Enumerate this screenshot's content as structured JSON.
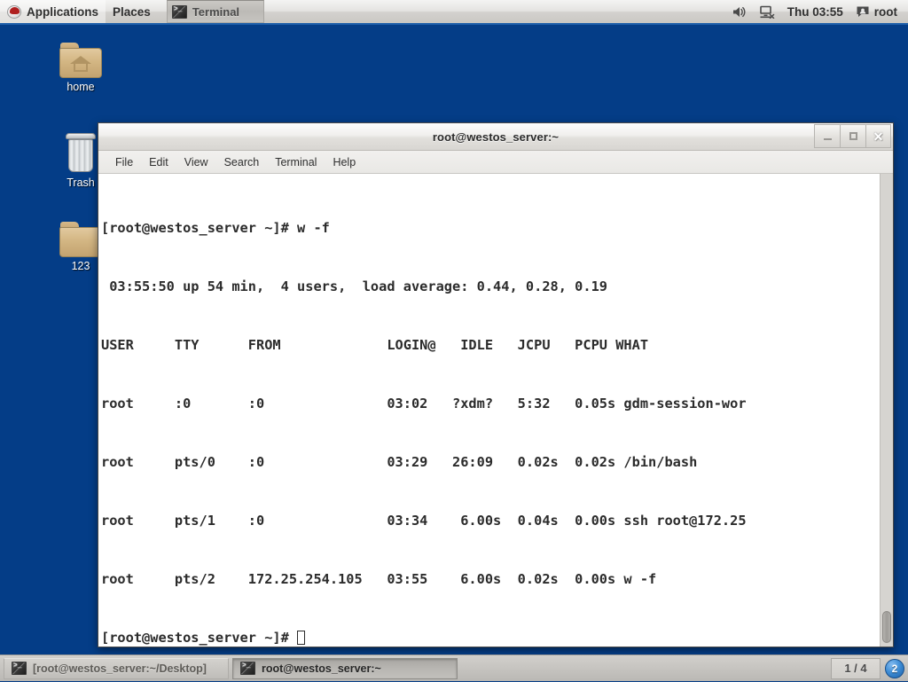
{
  "top_panel": {
    "applications_label": "Applications",
    "places_label": "Places",
    "window_list": [
      {
        "label": "Terminal",
        "icon": "terminal-icon",
        "active": true
      }
    ],
    "tray": {
      "volume_icon": "volume-icon",
      "network_icon": "network-disconnected-icon",
      "clock": "Thu 03:55",
      "user_icon": "user-icon",
      "user_label": "root"
    }
  },
  "desktop": {
    "background_color": "#043d87",
    "icons": [
      {
        "label": "home",
        "icon": "home-folder-icon"
      },
      {
        "label": "Trash",
        "icon": "trash-icon"
      },
      {
        "label": "123",
        "icon": "folder-icon"
      }
    ]
  },
  "terminal": {
    "title": "root@westos_server:~",
    "window_buttons": {
      "minimize": "minimize-icon",
      "maximize": "maximize-icon",
      "close": "close-icon"
    },
    "menubar": [
      "File",
      "Edit",
      "View",
      "Search",
      "Terminal",
      "Help"
    ],
    "lines": [
      "[root@westos_server ~]# w -f",
      " 03:55:50 up 54 min,  4 users,  load average: 0.44, 0.28, 0.19",
      "USER     TTY      FROM             LOGIN@   IDLE   JCPU   PCPU WHAT",
      "root     :0       :0               03:02   ?xdm?   5:32   0.05s gdm-session-wor",
      "root     pts/0    :0               03:29   26:09   0.02s  0.02s /bin/bash",
      "root     pts/1    :0               03:34    6.00s  0.04s  0.00s ssh root@172.25",
      "root     pts/2    172.25.254.105   03:55    6.00s  0.02s  0.00s w -f"
    ],
    "prompt": "[root@westos_server ~]# ",
    "background_color": "#ffffff",
    "foreground_color": "#2b2b2b"
  },
  "bottom_panel": {
    "tasks": [
      {
        "label": "[root@westos_server:~/Desktop]",
        "icon": "terminal-icon",
        "state": "inactive"
      },
      {
        "label": "root@westos_server:~",
        "icon": "terminal-icon",
        "state": "active"
      }
    ],
    "workspace": "1 / 4",
    "notification_count": "2"
  }
}
